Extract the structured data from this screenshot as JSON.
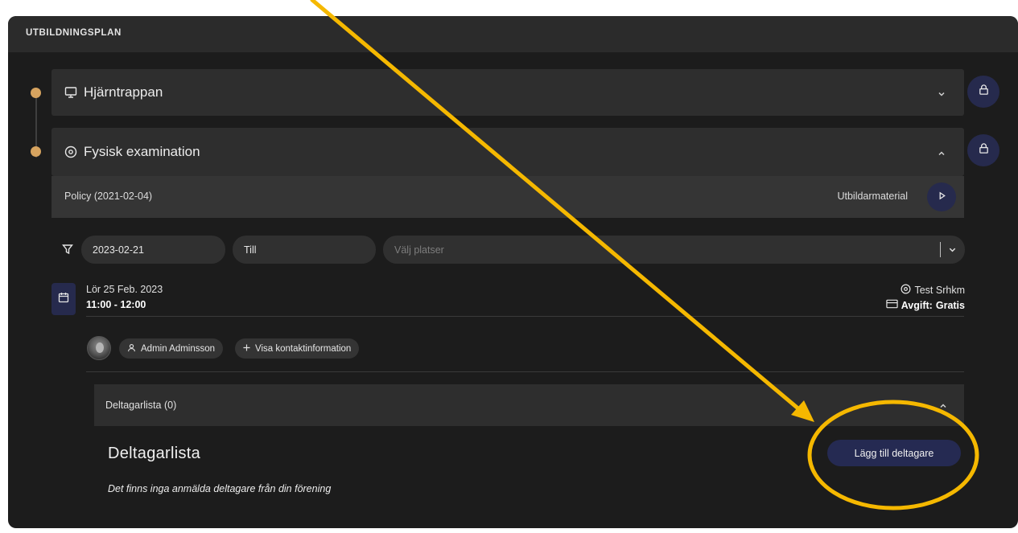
{
  "panel": {
    "title": "UTBILDNINGSPLAN"
  },
  "modules": [
    {
      "title": "Hjärntrappan",
      "icon": "monitor-icon",
      "expanded": false,
      "locked": true
    },
    {
      "title": "Fysisk examination",
      "icon": "map-pin-icon",
      "expanded": true,
      "locked": true
    }
  ],
  "policy": {
    "label": "Policy (2021-02-04)",
    "material_label": "Utbildarmaterial"
  },
  "filter": {
    "from_value": "2023-02-21",
    "to_value": "Till",
    "location_placeholder": "Välj platser"
  },
  "session": {
    "date": "Lör 25 Feb. 2023",
    "time": "11:00 - 12:00",
    "location": "Test Srhkm",
    "fee_label": "Avgift:",
    "fee_value": "Gratis",
    "instructor": "Admin Adminsson",
    "contact_button": "Visa kontaktinformation"
  },
  "participants": {
    "list_header": "Deltagarlista (0)",
    "section_title": "Deltagarlista",
    "add_button": "Lägg till deltagare",
    "empty_message": "Det finns inga anmälda deltagare från din förening"
  },
  "colors": {
    "panel_bg": "#1c1c1c",
    "accent_navy": "#262a4d",
    "timeline_dot": "#d6a35f",
    "annotation_yellow": "#f5b800"
  }
}
